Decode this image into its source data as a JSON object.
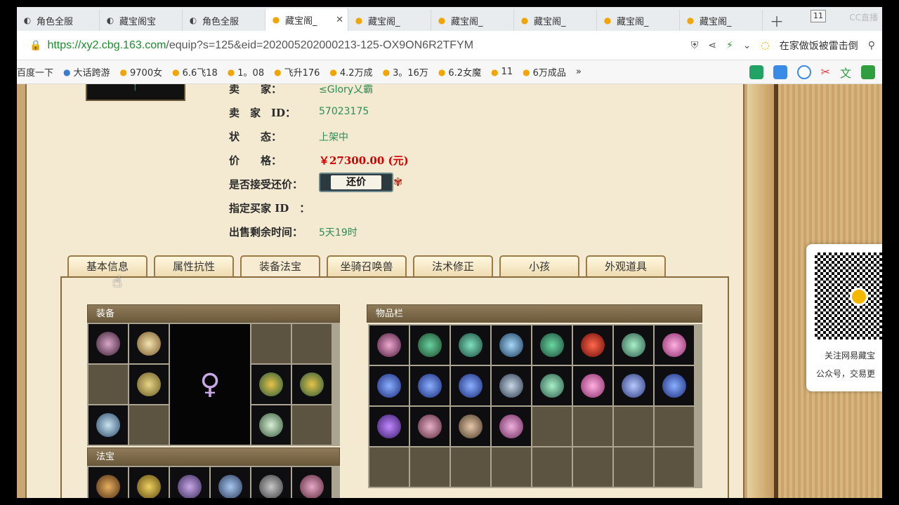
{
  "browser": {
    "tabs": [
      {
        "label": "角色全服",
        "icon": "c"
      },
      {
        "label": "藏宝阁宝",
        "icon": "c"
      },
      {
        "label": "角色全服",
        "icon": "c"
      },
      {
        "label": "藏宝阁_",
        "icon": "duck",
        "active": true
      },
      {
        "label": "藏宝阁_",
        "icon": "duck"
      },
      {
        "label": "藏宝阁_",
        "icon": "duck"
      },
      {
        "label": "藏宝阁_",
        "icon": "duck"
      },
      {
        "label": "藏宝阁_",
        "icon": "duck"
      },
      {
        "label": "藏宝阁_",
        "icon": "duck"
      }
    ],
    "tab_count": "11",
    "watermark": "CC直播",
    "url_host": "https://xy2.cbg.163.com",
    "url_rest": "/equip?s=125&eid=202005202000213-125-OX9ON6R2TFYM",
    "suggestion": "在家做饭被雷击倒",
    "bookmarks": [
      "百度一下",
      "大话跨游",
      "9700女",
      "6.6飞18",
      "1。08",
      "飞升176",
      "4.2万成",
      "3。16万",
      "6.2女魔",
      "11",
      "6万成品"
    ],
    "bookmark_more": "»"
  },
  "seller": {
    "seller_label": "卖　　家：",
    "seller_name": "≤Glory乂霸",
    "id_label": "卖　家　ID：",
    "id_value": "57023175",
    "status_label": "状　　态：",
    "status_value": "上架中",
    "price_label": "价　　格：",
    "price_value": "￥27300.00 (元)",
    "counter_label": "是否接受还价：",
    "counter_button": "还价",
    "buyer_label": "指定买家 ID　：",
    "time_label": "出售剩余时间：",
    "time_value": "5天19时"
  },
  "tabs": [
    "基本信息",
    "属性抗性",
    "装备法宝",
    "坐骑召唤兽",
    "法术修正",
    "小孩",
    "外观道具"
  ],
  "active_tab": 2,
  "equip_title": "装备",
  "fabao_title": "法宝",
  "inventory_title": "物品栏",
  "qr": {
    "line1": "关注网易藏宝",
    "line2": "公众号，交易更"
  },
  "colors": {
    "seller_value": "#2e8b57",
    "price": "#d20000",
    "panel_bg": "#f4ead1"
  }
}
